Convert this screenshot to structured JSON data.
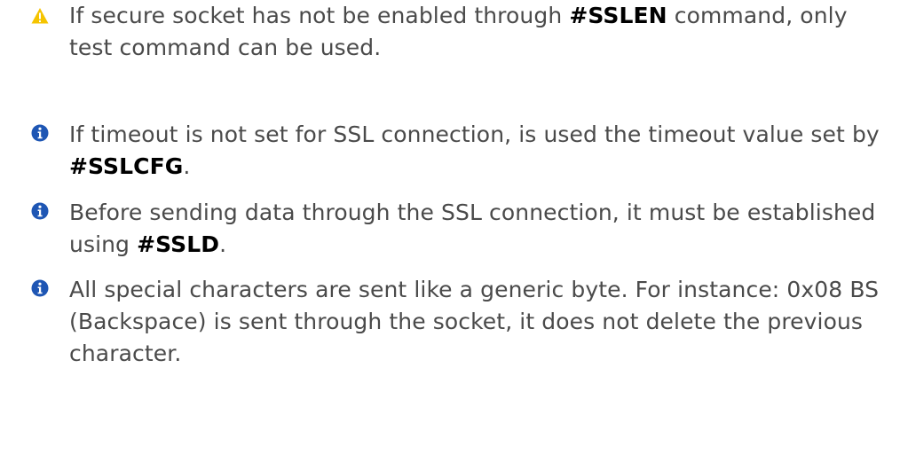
{
  "notes": [
    {
      "icon": "warning-icon",
      "before": "If secure socket has not be enabled through ",
      "command": "#SSLEN",
      "after": " command, only test command can be used."
    },
    {
      "icon": "info-icon",
      "before": "If timeout is not set for SSL connection, is used the timeout value set by ",
      "command": "#SSLCFG",
      "after": "."
    },
    {
      "icon": "info-icon",
      "before": "Before sending data through the SSL connection, it must be established using ",
      "command": "#SSLD",
      "after": "."
    },
    {
      "icon": "info-icon",
      "before": "All special characters are sent like a generic byte. For instance: 0x08 BS (Backspace) is sent through the socket, it does not delete the previous character."
    }
  ],
  "colors": {
    "warning": "#f5c400",
    "info": "#1e56b4",
    "text": "#4a4a4a",
    "command": "#000000"
  }
}
